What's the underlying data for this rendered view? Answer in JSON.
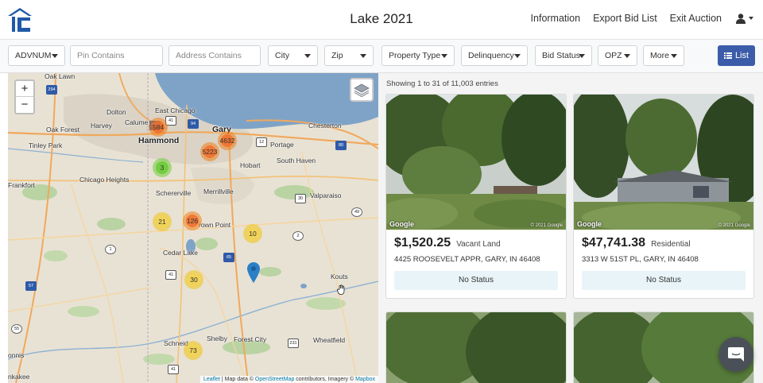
{
  "app": {
    "title": "Lake 2021",
    "brand_color": "#1f5aa6"
  },
  "nav": {
    "links": [
      {
        "label": "Information"
      },
      {
        "label": "Export Bid List"
      },
      {
        "label": "Exit Auction"
      }
    ],
    "user_icon": "user-icon"
  },
  "filters": {
    "advnum": "ADVNUM",
    "pin_placeholder": "Pin Contains",
    "address_placeholder": "Address Contains",
    "city": "City",
    "zip": "Zip",
    "property_type": "Property Type",
    "delinquency": "Delinquency",
    "bid_status": "Bid Status",
    "opz": "OPZ",
    "more": "More",
    "list_button": "List",
    "list_button_color": "#3b5ca8"
  },
  "map": {
    "zoom_in": "+",
    "zoom_out": "−",
    "places": {
      "oak_lawn": "Oak Lawn",
      "dolton": "Dolton",
      "east_chicago": "East Chicago",
      "oak_forest": "Oak Forest",
      "harvey": "Harvey",
      "calumet": "Calume",
      "gary": "Gary",
      "chesterton": "Chesterton",
      "tinley_park": "Tinley Park",
      "hammond": "Hammond",
      "portage": "Portage",
      "hobart": "Hobart",
      "south_haven": "South Haven",
      "chicago_heights": "Chicago Heights",
      "frankfort": "Frankfort",
      "schererville": "Schererville",
      "merrillville": "Merrillville",
      "valparaiso": "Valparaiso",
      "crown_point": "rown Point",
      "cedar_lake": "Cedar Lake",
      "kouts": "Kouts",
      "schneider": "Schneid",
      "shelby": "Shelby",
      "forest_city": "Forest City",
      "wheatfield": "Wheatfield",
      "monis": "onnis",
      "kankakee": "nkakee"
    },
    "clusters": {
      "c584": "584",
      "c4632": "4632",
      "c5223": "5223",
      "c3": "3",
      "c126": "126",
      "c21": "21",
      "c10": "10",
      "c30": "30",
      "c73": "73"
    },
    "route_shields": {
      "s294": "294",
      "s41a": "41",
      "s94": "94",
      "s80": "80",
      "s12": "12",
      "s30": "30",
      "s49": "49",
      "s2": "2",
      "s65": "65",
      "s41b": "41",
      "s1": "1",
      "s57": "57",
      "s231": "231",
      "s41c": "41",
      "s394": "394",
      "s55": "55"
    },
    "attribution": {
      "leaflet": "Leaflet",
      "sep1": " | Map data © ",
      "osm": "OpenStreetMap",
      "contrib": " contributors, Imagery © ",
      "mapbox": "Mapbox"
    }
  },
  "listings": {
    "summary": "Showing 1 to 31 of 11,003 entries",
    "cards": [
      {
        "price": "$1,520.25",
        "type": "Vacant Land",
        "address": "4425 ROOSEVELT APPR, GARY, IN 46408",
        "status": "No Status",
        "google_label": "Google",
        "copyright": "© 2021 Google"
      },
      {
        "price": "$47,741.38",
        "type": "Residential",
        "address": "3313 W 51ST PL, GARY, IN 46408",
        "status": "No Status",
        "google_label": "Google",
        "copyright": "© 2021 Google"
      }
    ]
  },
  "chat_icon": "chat-bubble-icon"
}
